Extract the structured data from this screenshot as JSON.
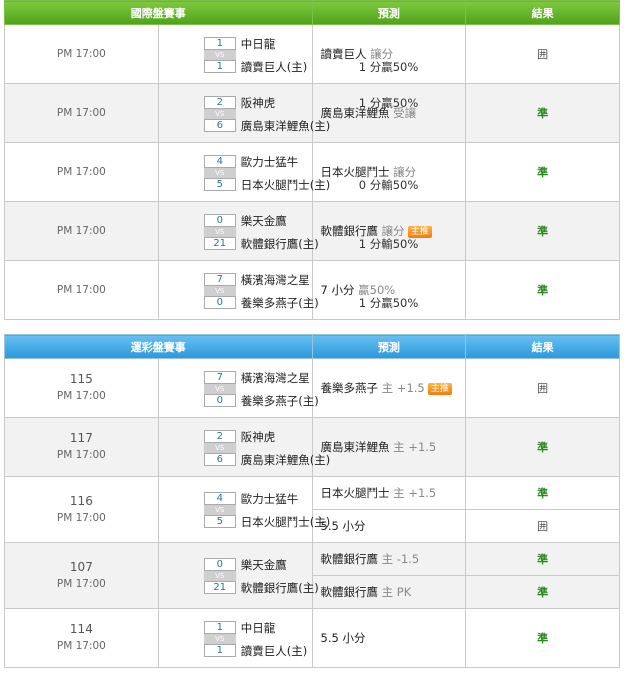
{
  "table1": {
    "header": {
      "matches": "國際盤賽事",
      "prediction": "預測",
      "result": "結果"
    },
    "rows": [
      {
        "time": "PM 17:00",
        "away_score": "1",
        "home_score": "1",
        "away_team": "中日龍",
        "home_team": "讀賣巨人(主)",
        "odds": "1 分贏50%",
        "odds_row": "bottom",
        "pred": "讀賣巨人",
        "pred_extra": "讓分",
        "badge": "",
        "result": "囲"
      },
      {
        "time": "PM 17:00",
        "away_score": "2",
        "home_score": "6",
        "away_team": "阪神虎",
        "home_team": "廣島東洋鯉魚(主)",
        "odds": "1 分贏50%",
        "odds_row": "top",
        "pred": "廣島東洋鯉魚",
        "pred_extra": "受讓",
        "badge": "",
        "result": "準"
      },
      {
        "time": "PM 17:00",
        "away_score": "4",
        "home_score": "5",
        "away_team": "歐力士猛牛",
        "home_team": "日本火腿鬥士(主)",
        "odds": "0 分輸50%",
        "odds_row": "bottom",
        "pred": "日本火腿鬥士",
        "pred_extra": "讓分",
        "badge": "",
        "result": "準"
      },
      {
        "time": "PM 17:00",
        "away_score": "0",
        "home_score": "21",
        "away_team": "樂天金鷹",
        "home_team": "軟體銀行鷹(主)",
        "odds": "1 分輸50%",
        "odds_row": "bottom",
        "pred": "軟體銀行鷹",
        "pred_extra": "讓分",
        "badge": "主推",
        "result": "準"
      },
      {
        "time": "PM 17:00",
        "away_score": "7",
        "home_score": "0",
        "away_team": "橫濱海灣之星",
        "home_team": "養樂多燕子(主)",
        "odds": "1 分贏50%",
        "odds_row": "bottom",
        "pred": "7 小分",
        "pred_extra": "贏50%",
        "badge": "",
        "result": "準"
      }
    ]
  },
  "table2": {
    "header": {
      "matches": "運彩盤賽事",
      "prediction": "預測",
      "result": "結果"
    },
    "rows": [
      {
        "num": "115",
        "time": "PM 17:00",
        "away_score": "7",
        "home_score": "0",
        "away_team": "橫濱海灣之星",
        "home_team": "養樂多燕子(主)",
        "preds": [
          {
            "team": "養樂多燕子",
            "extra": "主 +1.5",
            "badge": "主推",
            "result": "囲"
          }
        ]
      },
      {
        "num": "117",
        "time": "PM 17:00",
        "away_score": "2",
        "home_score": "6",
        "away_team": "阪神虎",
        "home_team": "廣島東洋鯉魚(主)",
        "preds": [
          {
            "team": "廣島東洋鯉魚",
            "extra": "主 +1.5",
            "badge": "",
            "result": "準"
          }
        ]
      },
      {
        "num": "116",
        "time": "PM 17:00",
        "away_score": "4",
        "home_score": "5",
        "away_team": "歐力士猛牛",
        "home_team": "日本火腿鬥士(主)",
        "preds": [
          {
            "team": "日本火腿鬥士",
            "extra": "主 +1.5",
            "badge": "",
            "result": "準"
          },
          {
            "team": "5.5 小分",
            "extra": "",
            "badge": "",
            "result": "囲"
          }
        ]
      },
      {
        "num": "107",
        "time": "PM 17:00",
        "away_score": "0",
        "home_score": "21",
        "away_team": "樂天金鷹",
        "home_team": "軟體銀行鷹(主)",
        "preds": [
          {
            "team": "軟體銀行鷹",
            "extra": "主 -1.5",
            "badge": "",
            "result": "準"
          },
          {
            "team": "軟體銀行鷹",
            "extra": "主 PK",
            "badge": "",
            "result": "準"
          }
        ]
      },
      {
        "num": "114",
        "time": "PM 17:00",
        "away_score": "1",
        "home_score": "1",
        "away_team": "中日龍",
        "home_team": "讀賣巨人(主)",
        "preds": [
          {
            "team": "5.5 小分",
            "extra": "",
            "badge": "",
            "result": "準"
          }
        ]
      }
    ]
  },
  "colors": {
    "green_header": "#4ea21a",
    "blue_header": "#2b98db",
    "result_green": "#2a8a1e",
    "badge_orange": "#f07d0a"
  }
}
